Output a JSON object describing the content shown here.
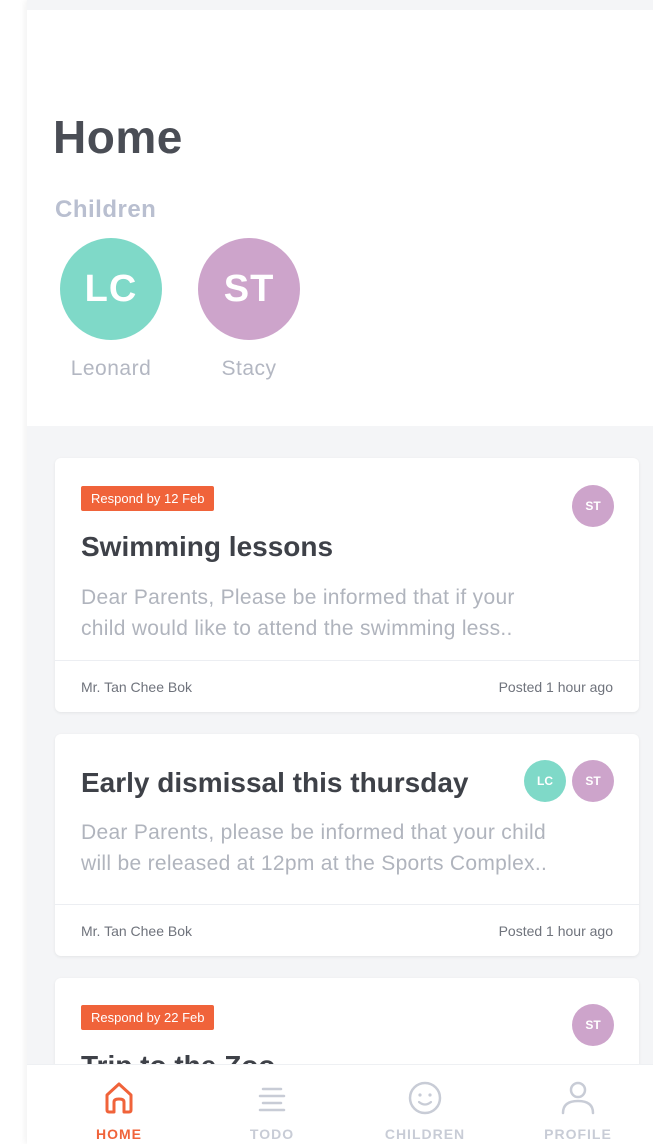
{
  "colors": {
    "accent": "#f0633a",
    "leonard": "#7fd9c8",
    "stacy": "#cda4cb",
    "tab_inactive": "#c8ccd6"
  },
  "page_title": "Home",
  "children_section": {
    "label": "Children",
    "children": [
      {
        "initials": "LC",
        "name": "Leonard"
      },
      {
        "initials": "ST",
        "name": "Stacy"
      }
    ]
  },
  "cards": [
    {
      "badge": "Respond by 12 Feb",
      "title": "Swimming lessons",
      "text_line1": "Dear Parents, Please be informed that if your",
      "text_line2": "child would like to attend the swimming less..",
      "avatars": [
        "ST"
      ],
      "author": "Mr. Tan Chee Bok",
      "posted": "Posted 1 hour ago"
    },
    {
      "badge": "",
      "title": "Early dismissal this thursday",
      "text_line1": "Dear Parents, please be informed that your child",
      "text_line2": "will be released at 12pm at the Sports Complex..",
      "avatars": [
        "LC",
        "ST"
      ],
      "author": "Mr. Tan Chee Bok",
      "posted": "Posted 1 hour ago"
    },
    {
      "badge": "Respond by 22 Feb",
      "title": "Trip to the Zoo",
      "avatars": [
        "ST"
      ]
    }
  ],
  "tabbar": {
    "tabs": [
      {
        "label": "HOME",
        "icon": "home-icon",
        "active": true
      },
      {
        "label": "TODO",
        "icon": "list-icon",
        "active": false
      },
      {
        "label": "CHILDREN",
        "icon": "smiley-icon",
        "active": false
      },
      {
        "label": "PROFILE",
        "icon": "person-icon",
        "active": false
      }
    ]
  }
}
